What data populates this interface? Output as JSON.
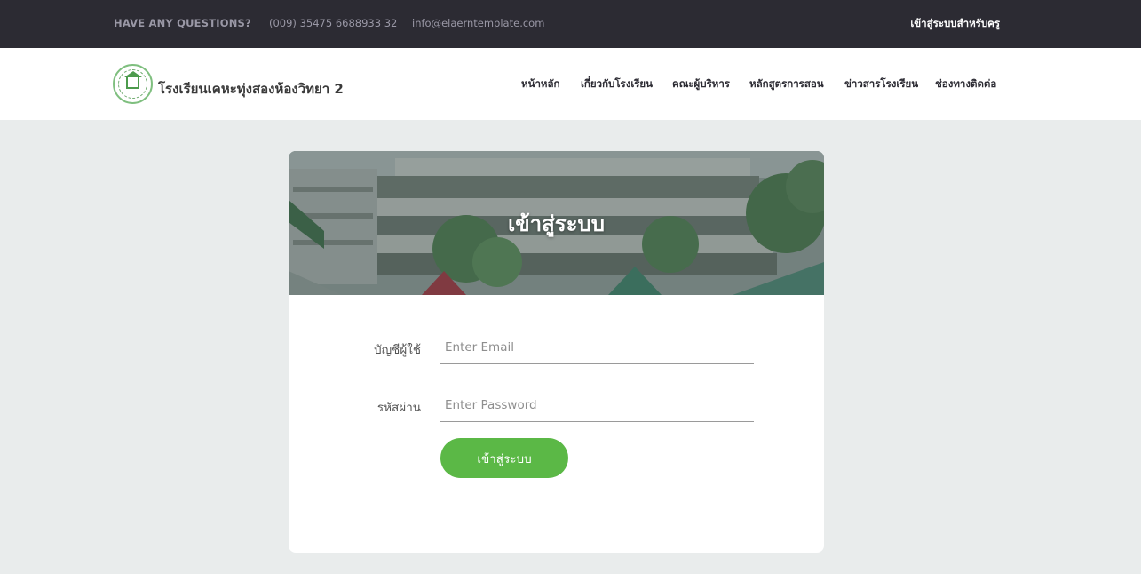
{
  "topbar": {
    "questions": "HAVE ANY QUESTIONS?",
    "phone": "(009) 35475 6688933 32",
    "email": "info@elaerntemplate.com",
    "teacher_login": "เข้าสู่ระบบสำหรับครู"
  },
  "header": {
    "school_name": "โรงเรียนเคหะทุ่งสองห้องวิทยา 2",
    "nav": [
      {
        "label": "หน้าหลัก"
      },
      {
        "label": "เกี่ยวกับโรงเรียน"
      },
      {
        "label": "คณะผู้บริหาร"
      },
      {
        "label": "หลักสูตรการสอน"
      },
      {
        "label": "ข่าวสารโรงเรียน"
      },
      {
        "label": "ช่องทางติดต่อ"
      }
    ]
  },
  "login": {
    "title": "เข้าสู่ระบบ",
    "account_label": "บัญชีผู้ใช้",
    "email_placeholder": "Enter Email",
    "email_value": "",
    "password_label": "รหัสผ่าน",
    "password_placeholder": "Enter Password",
    "password_value": "",
    "submit_label": "เข้าสู่ระบบ"
  },
  "colors": {
    "topbar_bg": "#2c2b33",
    "page_bg": "#e9ecec",
    "accent_green": "#5bb846"
  }
}
